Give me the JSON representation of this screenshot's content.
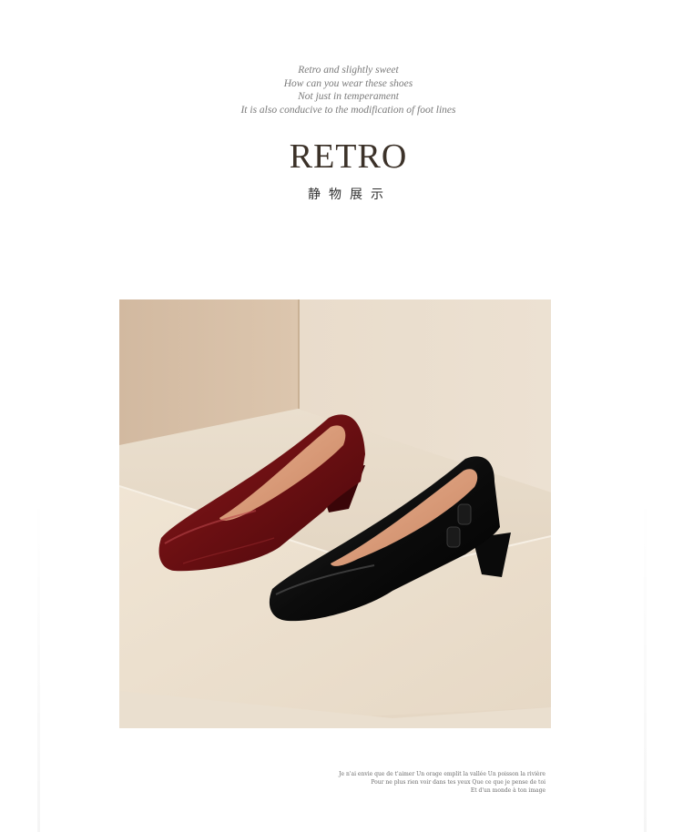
{
  "intro_lines": [
    "Retro and slightly sweet",
    "How can you wear these shoes",
    "Not just in temperament",
    "It is also conducive to the modification of foot lines"
  ],
  "title": "RETRO",
  "subtitle": "静物展示",
  "photo": {
    "subject": "burgundy and black patent leather square-toe block-heel pumps on beige steps"
  },
  "caption_lines": [
    "Je n'ai envie que de t'aimer Un orage emplit la vallée Un poisson la rivière",
    "Pour ne plus rien voir dans tes yeux Que ce que je pense de toi",
    "Et d'un monde à ton image"
  ]
}
